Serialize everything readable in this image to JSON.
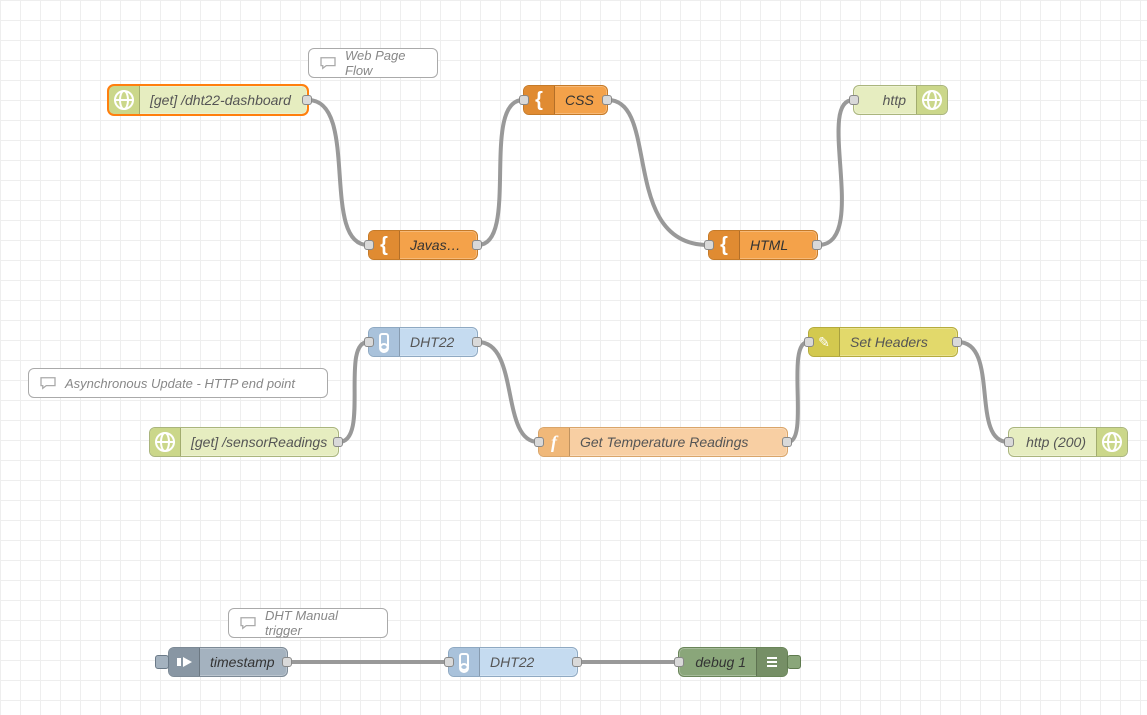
{
  "comments": {
    "c1": "Web Page Flow",
    "c2": "Asynchronous Update - HTTP end point",
    "c3": "DHT Manual trigger"
  },
  "nodes": {
    "httpin1": "[get] /dht22-dashboard",
    "javascript": "Javascript",
    "css": "CSS",
    "html": "HTML",
    "httpout1": "http",
    "httpin2": "[get] /sensorReadings",
    "dht22a": "DHT22",
    "getTemp": "Get Temperature Readings",
    "setHeaders": "Set Headers",
    "httpout2": "http (200)",
    "inject": "timestamp",
    "dht22b": "DHT22",
    "debug": "debug 1"
  }
}
